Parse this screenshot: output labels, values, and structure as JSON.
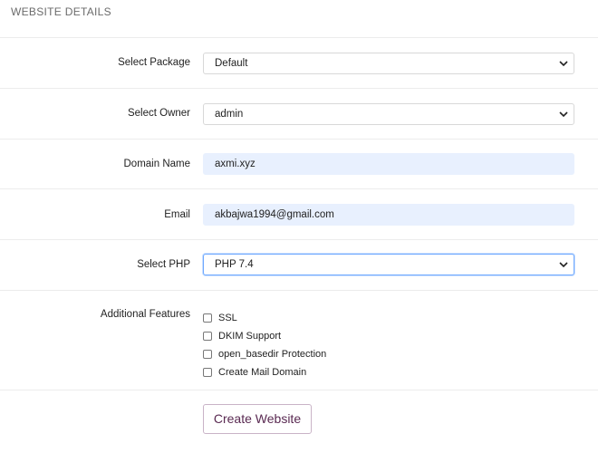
{
  "section_title": "WEBSITE DETAILS",
  "form": {
    "package": {
      "label": "Select Package",
      "value": "Default"
    },
    "owner": {
      "label": "Select Owner",
      "value": "admin"
    },
    "domain": {
      "label": "Domain Name",
      "value": "axmi.xyz"
    },
    "email": {
      "label": "Email",
      "value": "akbajwa1994@gmail.com"
    },
    "php": {
      "label": "Select PHP",
      "value": "PHP 7.4"
    },
    "features": {
      "label": "Additional Features",
      "items": [
        {
          "label": "SSL",
          "checked": false
        },
        {
          "label": "DKIM Support",
          "checked": false
        },
        {
          "label": "open_basedir Protection",
          "checked": false
        },
        {
          "label": "Create Mail Domain",
          "checked": false
        }
      ]
    },
    "submit_label": "Create Website"
  },
  "colors": {
    "autofill_bg": "#e8f0fe",
    "focus_border": "#6ea8ff",
    "button_text": "#5a2a52"
  }
}
